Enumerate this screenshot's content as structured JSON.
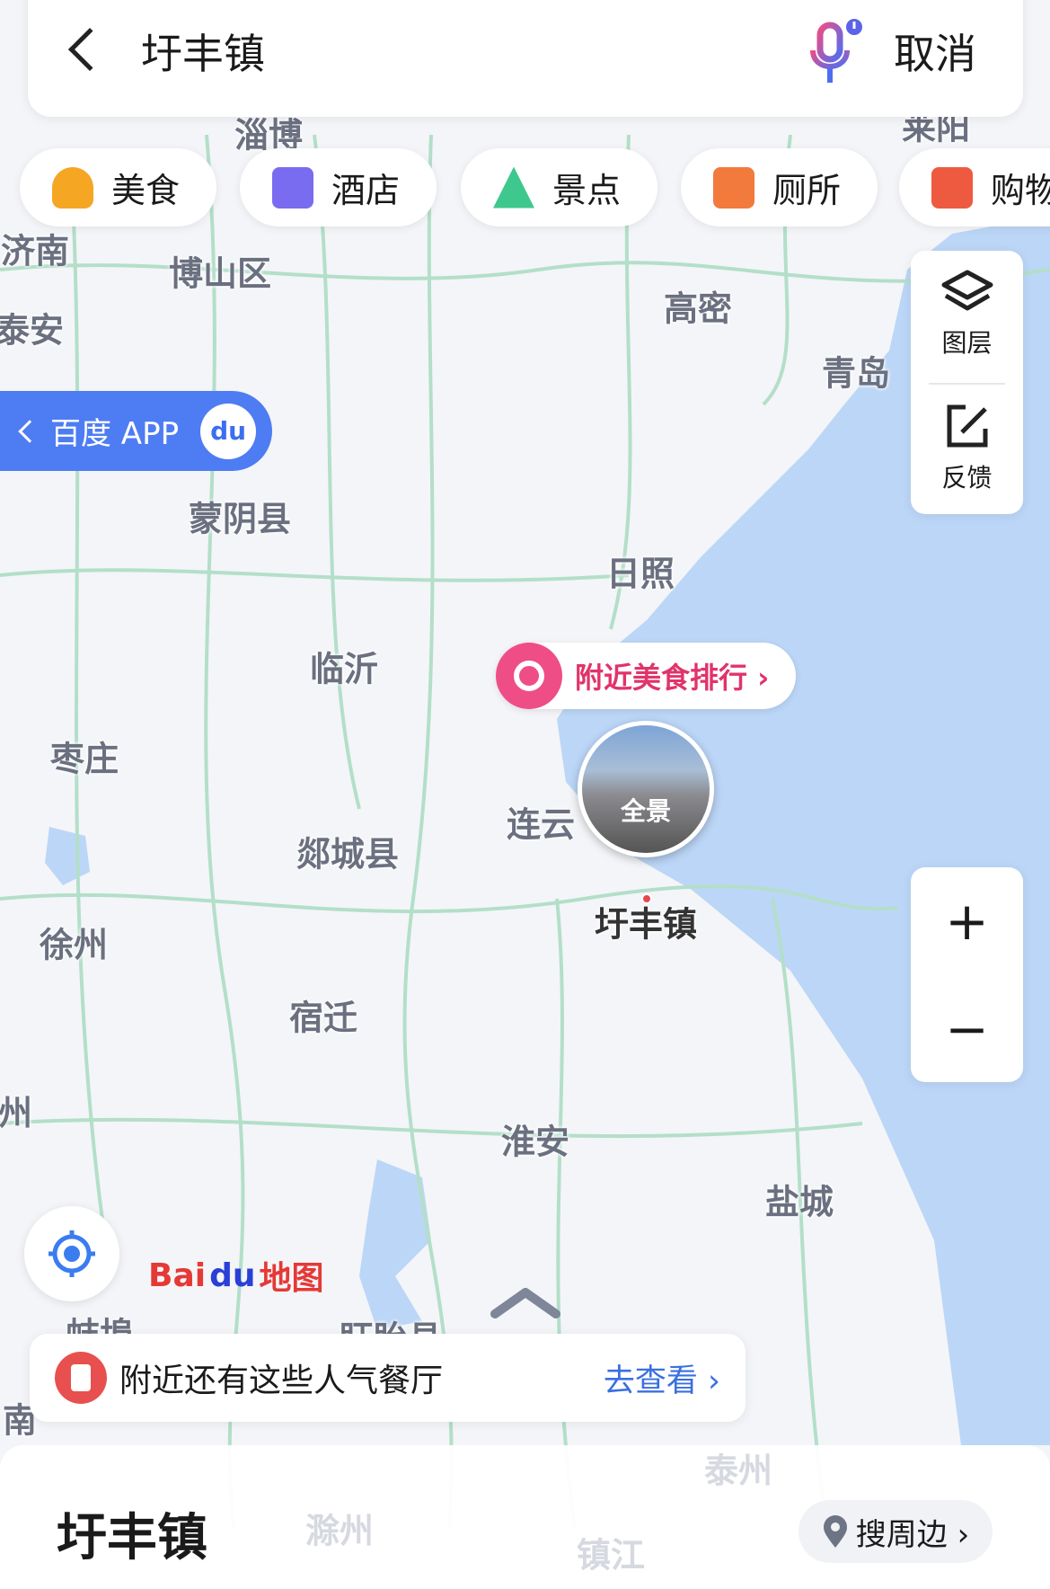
{
  "header": {
    "title": "圩丰镇",
    "cancel_label": "取消",
    "back_icon": "chevron-left-icon",
    "voice_icon": "microphone-icon"
  },
  "categories": [
    {
      "label": "美食",
      "icon": "food-icon",
      "color": "#f5a623"
    },
    {
      "label": "酒店",
      "icon": "hotel-icon",
      "color": "#7a6cf0"
    },
    {
      "label": "景点",
      "icon": "scenic-icon",
      "color": "#3ec88d"
    },
    {
      "label": "厕所",
      "icon": "toilet-icon",
      "color": "#f27a3c"
    },
    {
      "label": "购物",
      "icon": "shopping-icon",
      "color": "#ee5a40"
    }
  ],
  "side_panel": {
    "layers_label": "图层",
    "feedback_label": "反馈"
  },
  "app_button": {
    "label": "百度 APP",
    "logo": "du"
  },
  "food_rank": {
    "label": "附近美食排行 ›"
  },
  "panorama": {
    "label": "全景"
  },
  "zoom": {
    "in": "+",
    "out": "−"
  },
  "logo": {
    "text_bai": "Bai",
    "text_du": "du",
    "text_map": "地图"
  },
  "map_labels": [
    "淄博",
    "莱阳",
    "济南",
    "博山区",
    "泰安",
    "高密",
    "青岛",
    "蒙阴县",
    "日照",
    "临沂",
    "枣庄",
    "连云",
    "郯城县",
    "圩丰镇",
    "徐州",
    "宿迁",
    "州",
    "淮安",
    "盐城",
    "蚌埠",
    "盱眙县",
    "南",
    "泰州",
    "滁州",
    "镇江"
  ],
  "banner": {
    "text": "附近还有这些人气餐厅",
    "link": "去查看 ›"
  },
  "sheet": {
    "title": "圩丰镇",
    "nearby_label": "搜周边 ›"
  },
  "colors": {
    "accent": "#3a6fe0",
    "sea": "#bcd6f7",
    "road": "#a8dcc4",
    "land": "#f4f5f8"
  }
}
